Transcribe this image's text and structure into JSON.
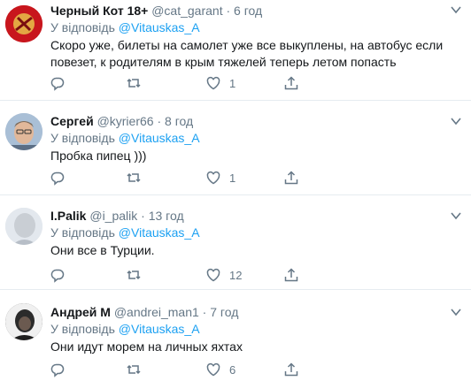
{
  "tweets": [
    {
      "name": "Черный Кот 18+",
      "handle": "@cat_garant",
      "dot": "·",
      "time": "6 год",
      "reply_prefix": "У відповідь",
      "reply_to": "@Vitauskas_A",
      "text": "Скоро уже, билеты на самолет уже все выкуплены, на автобус если повезет, к родителям в крым тяжелей теперь летом попасть",
      "likes": "1",
      "avatar_color": "#c8161d"
    },
    {
      "name": "Сергей",
      "handle": "@kyrier66",
      "dot": "·",
      "time": "8 год",
      "reply_prefix": "У відповідь",
      "reply_to": "@Vitauskas_A",
      "text": "Пробка пипец )))",
      "likes": "1",
      "avatar_color": "#9bb0c8"
    },
    {
      "name": "I.Palik",
      "handle": "@i_palik",
      "dot": "·",
      "time": "13 год",
      "reply_prefix": "У відповідь",
      "reply_to": "@Vitauskas_A",
      "text": "Они все в Турции.",
      "likes": "12",
      "avatar_color": "#d7dde4"
    },
    {
      "name": "Андрей М",
      "handle": "@andrei_man1",
      "dot": "·",
      "time": "7 год",
      "reply_prefix": "У відповідь",
      "reply_to": "@Vitauskas_A",
      "text": "Они идут морем на личных яхтах",
      "likes": "6",
      "avatar_color": "#3a3a3a"
    }
  ],
  "colors": {
    "accent": "#1da1f2",
    "muted": "#657786",
    "text": "#14171a",
    "divider": "#e6ecf0"
  },
  "icons": [
    "reply-icon",
    "retweet-icon",
    "like-icon",
    "share-icon",
    "chevron-down-icon"
  ]
}
